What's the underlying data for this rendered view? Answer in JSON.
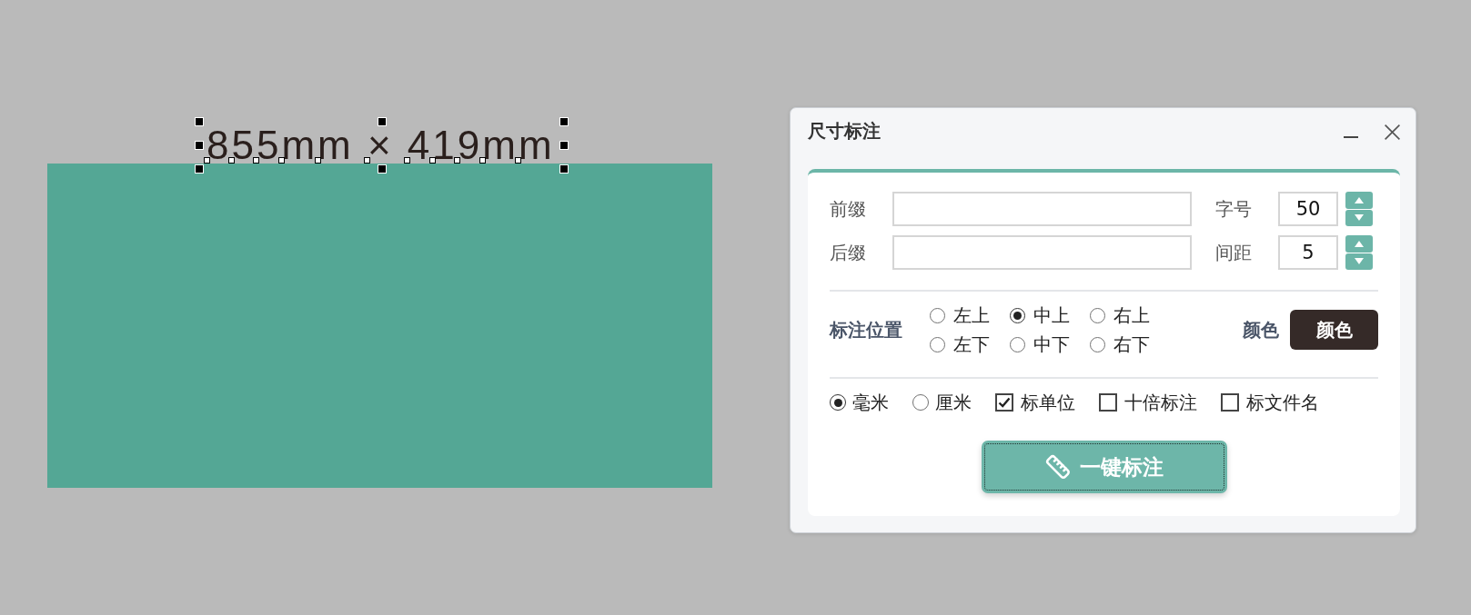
{
  "canvas": {
    "dimension_label": {
      "text": "855mm × 419mm",
      "selected": true
    }
  },
  "dialog": {
    "title": "尺寸标注",
    "field_rows": [
      {
        "text_field": {
          "label": "前缀"
        },
        "number_field": {
          "label": "字号",
          "value": "50"
        }
      },
      {
        "text_field": {
          "label": "后缀"
        },
        "number_field": {
          "label": "间距",
          "value": "5"
        }
      }
    ],
    "position": {
      "label": "标注位置",
      "options": [
        {
          "label": "左上",
          "selected": false
        },
        {
          "label": "中上",
          "selected": true
        },
        {
          "label": "右上",
          "selected": false
        },
        {
          "label": "左下",
          "selected": false
        },
        {
          "label": "中下",
          "selected": false
        },
        {
          "label": "右下",
          "selected": false
        }
      ]
    },
    "color": {
      "label": "颜色",
      "button": "颜色"
    },
    "options": [
      {
        "kind": "radio",
        "label": "毫米",
        "selected": true
      },
      {
        "kind": "radio",
        "label": "厘米",
        "selected": false
      },
      {
        "kind": "checkbox",
        "label": "标单位",
        "checked": true
      },
      {
        "kind": "checkbox",
        "label": "十倍标注",
        "checked": false
      },
      {
        "kind": "checkbox",
        "label": "标文件名",
        "checked": false
      }
    ],
    "action_button": {
      "label": "一键标注",
      "focused": true
    }
  }
}
